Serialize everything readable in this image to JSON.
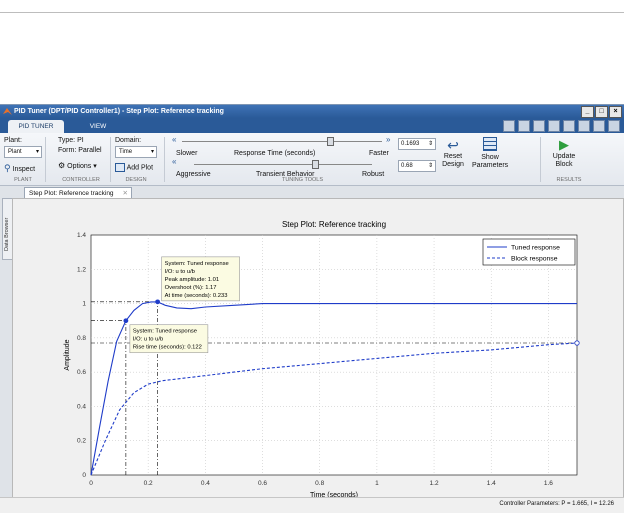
{
  "window": {
    "title": "PID Tuner (DPT/PID Controller1) - Step Plot: Reference tracking"
  },
  "tabs": [
    "PID TUNER",
    "VIEW"
  ],
  "toolstrip": {
    "plant_label": "Plant:",
    "plant_value": "Plant",
    "inspect_label": "Inspect",
    "type_label": "Type: PI",
    "form_label": "Form: Parallel",
    "options_label": "Options",
    "domain_label": "Domain:",
    "domain_value": "Time",
    "add_plot_label": "Add Plot",
    "slower_label": "Slower",
    "response_time_label": "Response Time (seconds)",
    "faster_label": "Faster",
    "response_time_value": "0.1693",
    "aggressive_label": "Aggressive",
    "transient_label": "Transient Behavior",
    "robust_label": "Robust",
    "transient_value": "0.68",
    "reset_design_label": "Reset Design",
    "show_parameters_label": "Show Parameters",
    "update_block_label": "Update Block",
    "sections": [
      "PLANT",
      "CONTROLLER",
      "DESIGN",
      "TUNING TOOLS",
      "RESULTS"
    ],
    "response_time_slider_fraction": 0.74,
    "transient_slider_fraction": 0.68
  },
  "document_tab": "Step Plot: Reference tracking",
  "sidebar_label": "Data Browser",
  "status_text": "Controller Parameters: P = 1.665, I = 12.26",
  "colors": {
    "tuned": "#1f3cc9",
    "block": "#1f3cc9",
    "titlebar": "#2a5a98"
  },
  "chart_data": {
    "type": "line",
    "title": "Step Plot: Reference tracking",
    "xlabel": "Time (seconds)",
    "ylabel": "Amplitude",
    "xlim": [
      0,
      1.7
    ],
    "ylim": [
      0,
      1.4
    ],
    "xticks": [
      0,
      0.2,
      0.4,
      0.6,
      0.8,
      1,
      1.2,
      1.4,
      1.6
    ],
    "yticks": [
      0,
      0.2,
      0.4,
      0.6,
      0.8,
      1,
      1.2,
      1.4
    ],
    "grid": true,
    "legend_position": "top-right",
    "series": [
      {
        "name": "Tuned response",
        "style": "solid",
        "x": [
          0,
          0.03,
          0.06,
          0.09,
          0.122,
          0.15,
          0.18,
          0.21,
          0.233,
          0.26,
          0.3,
          0.35,
          0.4,
          0.5,
          0.6,
          0.8,
          1.0,
          1.2,
          1.4,
          1.7
        ],
        "y": [
          0,
          0.28,
          0.55,
          0.78,
          0.9,
          0.96,
          1.0,
          1.01,
          1.01,
          0.99,
          0.975,
          0.97,
          0.98,
          0.99,
          1.0,
          1.0,
          1.0,
          1.0,
          1.0,
          1.0
        ]
      },
      {
        "name": "Block response",
        "style": "dashed",
        "x": [
          0,
          0.05,
          0.1,
          0.15,
          0.2,
          0.25,
          0.3,
          0.4,
          0.5,
          0.6,
          0.8,
          1.0,
          1.2,
          1.4,
          1.6,
          1.7
        ],
        "y": [
          0,
          0.2,
          0.38,
          0.48,
          0.53,
          0.55,
          0.56,
          0.58,
          0.6,
          0.62,
          0.65,
          0.68,
          0.71,
          0.73,
          0.76,
          0.77
        ]
      }
    ],
    "annotations": [
      {
        "lines": [
          "System: Tuned response",
          "I/O: u to u/b",
          "Peak amplitude: 1.01",
          "Overshoot (%): 1.17",
          "At time (seconds): 0.233"
        ],
        "point": [
          0.233,
          1.01
        ]
      },
      {
        "lines": [
          "System: Tuned response",
          "I/O: u to u/b",
          "Rise time (seconds): 0.122"
        ],
        "point": [
          0.122,
          0.9
        ]
      }
    ]
  }
}
